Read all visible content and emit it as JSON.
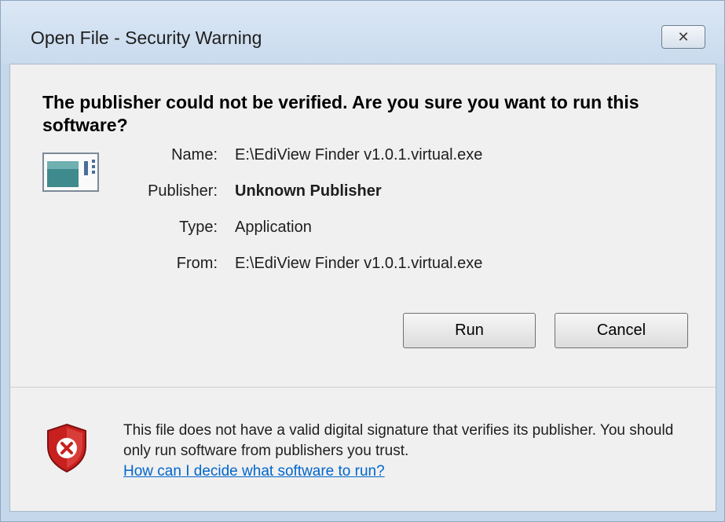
{
  "window": {
    "title": "Open File - Security Warning",
    "close_glyph": "✕"
  },
  "question": "The publisher could not be verified.  Are you sure you want to run this software?",
  "file_icon": "application-icon",
  "details": [
    {
      "label": "Name:",
      "value": "E:\\EdiView Finder v1.0.1.virtual.exe",
      "bold": false
    },
    {
      "label": "Publisher:",
      "value": "Unknown Publisher",
      "bold": true
    },
    {
      "label": "Type:",
      "value": "Application",
      "bold": false
    },
    {
      "label": "From:",
      "value": "E:\\EdiView Finder v1.0.1.virtual.exe",
      "bold": false
    }
  ],
  "buttons": {
    "run": "Run",
    "cancel": "Cancel"
  },
  "warning": {
    "icon": "security-shield-x-icon",
    "text": "This file does not have a valid digital signature that verifies its publisher.  You should only run software from publishers you trust.",
    "link": "How can I decide what software to run?"
  },
  "colors": {
    "link": "#0066cc",
    "shield": "#c8201e"
  }
}
